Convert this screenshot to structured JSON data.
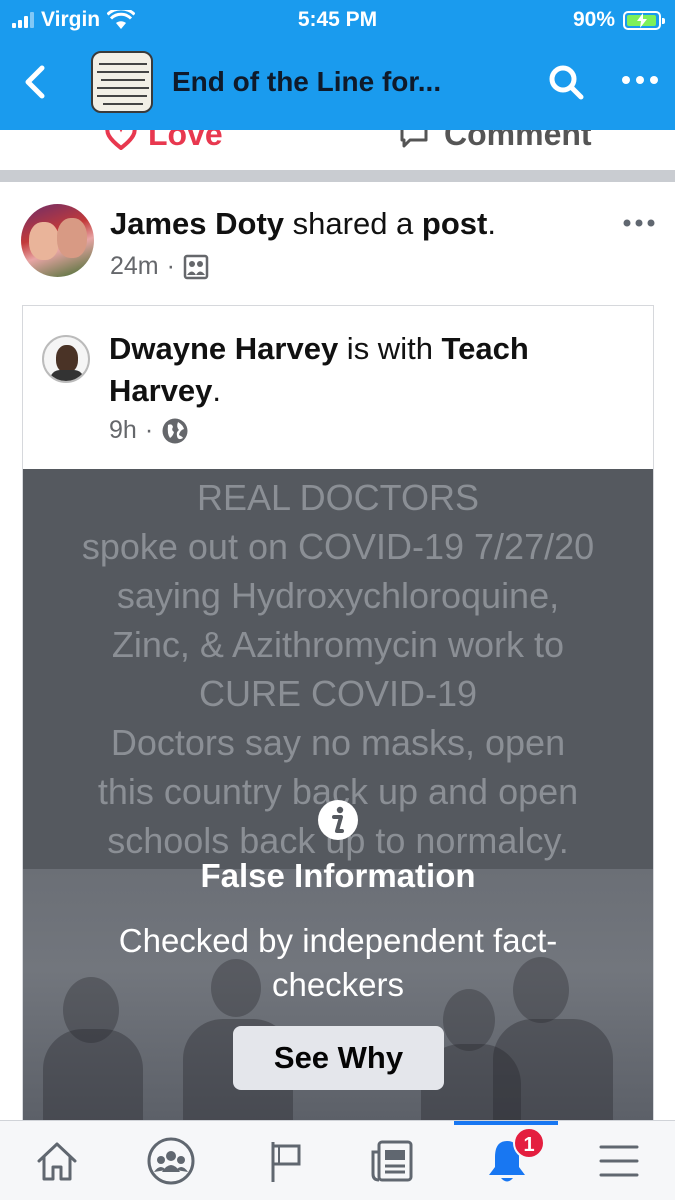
{
  "status_bar": {
    "carrier": "Virgin",
    "time": "5:45 PM",
    "battery": "90%",
    "battery_level": 0.9,
    "icons": [
      "signal-icon",
      "wifi-icon",
      "battery-charging-icon"
    ]
  },
  "header": {
    "title": "End of the Line for...",
    "thumbnail_text": "\"The world will not be destroyed by those who do evil, but by those who watch them without doing anything.\"",
    "icons": [
      "back-chevron-icon",
      "search-icon",
      "more-dots-icon"
    ]
  },
  "reactions": {
    "love_label": "Love",
    "comment_label": "Comment"
  },
  "post": {
    "author": "James Doty",
    "action_text": " shared a ",
    "object": "post",
    "period": ".",
    "time": "24m",
    "separator": "·",
    "audience_icon": "friends-photo-icon"
  },
  "shared_post": {
    "author": "Dwayne Harvey",
    "with_text": " is with ",
    "tagged_line1": "Teach",
    "tagged_line2": "Harvey",
    "period": ".",
    "time": "9h",
    "separator": "·",
    "audience_icon": "globe-icon",
    "image_text": [
      "REAL DOCTORS",
      "spoke out on COVID-19 7/27/20",
      "saying Hydroxychloroquine,",
      "Zinc, & Azithromycin work to",
      "CURE COVID-19",
      "Doctors say no masks, open",
      "this country back up and open",
      "schools back up to normalcy."
    ],
    "fact_check": {
      "title": "False Information",
      "subtitle": "Checked by independent fact-checkers",
      "button": "See Why"
    }
  },
  "tab_bar": {
    "tabs": [
      "home-icon",
      "groups-icon",
      "pages-flag-icon",
      "news-feed-icon",
      "notifications-bell-icon",
      "menu-icon"
    ],
    "active_tab": "notifications-bell-icon",
    "notification_count": "1",
    "accent_color": "#1877f2",
    "badge_color": "#e41e3f"
  },
  "colors": {
    "header_blue": "#1a9bee",
    "love_red": "#e8384f"
  }
}
